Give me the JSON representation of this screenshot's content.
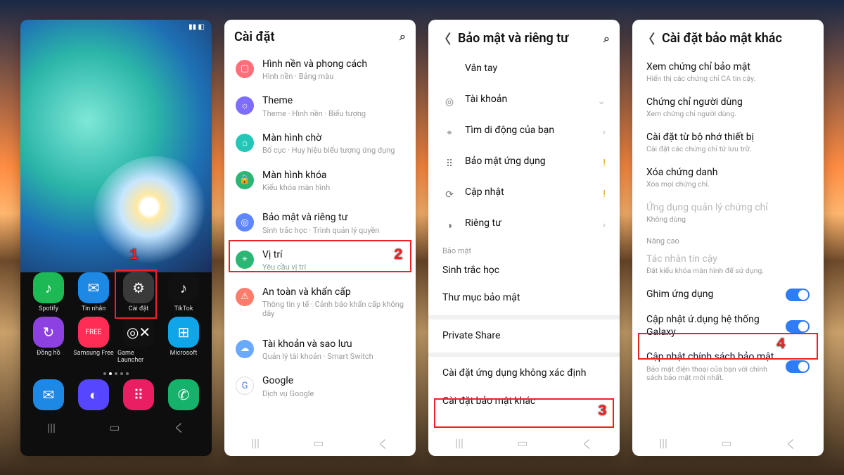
{
  "panel1": {
    "apps_row1": [
      {
        "name": "Spotify",
        "color": "#1db954",
        "glyph": "♪"
      },
      {
        "name": "Tin nhắn",
        "color": "#1e88e5",
        "glyph": "✉"
      },
      {
        "name": "Cài đặt",
        "color": "#3a3a3a",
        "glyph": "⚙"
      },
      {
        "name": "TikTok",
        "color": "#111",
        "glyph": "♪"
      }
    ],
    "apps_row2": [
      {
        "name": "Đồng hồ",
        "color": "#8d41e0",
        "glyph": "↻"
      },
      {
        "name": "Samsung Free",
        "color": "#ff2d55",
        "glyph": "FREE"
      },
      {
        "name": "Game Launcher",
        "color": "#111",
        "glyph": "◎✕"
      },
      {
        "name": "Microsoft",
        "color": "#0ea5e9",
        "glyph": "⊞"
      }
    ],
    "dock": [
      {
        "name": "Messages",
        "color": "#1e88e5",
        "glyph": "✉"
      },
      {
        "name": "Internet",
        "color": "#5746ff",
        "glyph": "◐"
      },
      {
        "name": "Apps",
        "color": "#e91e63",
        "glyph": "⠿"
      },
      {
        "name": "Phone",
        "color": "#16b26b",
        "glyph": "✆"
      }
    ],
    "step": "1"
  },
  "panel2": {
    "title": "Cài đặt",
    "items": [
      {
        "c": "#ff6f7a",
        "g": "▢",
        "t": "Hình nền và phong cách",
        "s": "Hình nền · Bảng màu"
      },
      {
        "c": "#7c6cff",
        "g": "☼",
        "t": "Theme",
        "s": "Theme · Hình nền · Biểu tượng"
      },
      {
        "c": "#25c6b8",
        "g": "⌂",
        "t": "Màn hình chờ",
        "s": "Bố cục · Huy hiệu biểu tượng ứng dụng"
      },
      {
        "c": "#2bb673",
        "g": "🔒",
        "t": "Màn hình khóa",
        "s": "Kiểu khóa màn hình"
      },
      {
        "c": "#5e86ff",
        "g": "◎",
        "t": "Bảo mật và riêng tư",
        "s": "Sinh trắc học · Trình quản lý quyền"
      },
      {
        "c": "#2bb673",
        "g": "⌖",
        "t": "Vị trí",
        "s": "Yêu cầu vị trí"
      },
      {
        "c": "#ff7b6b",
        "g": "⚠",
        "t": "An toàn và khẩn cấp",
        "s": "Thông tin y tế · Cảnh báo khẩn cấp không dây"
      },
      {
        "c": "#6aa9ff",
        "g": "☁",
        "t": "Tài khoản và sao lưu",
        "s": "Quản lý tài khoản · Smart Switch"
      },
      {
        "c": "#fff",
        "g": "G",
        "t": "Google",
        "s": "Dịch vụ Google",
        "gstyle": "color:#4285f4;border:1px solid #ddd"
      }
    ],
    "step": "2"
  },
  "panel3": {
    "title": "Bảo mật và riêng tư",
    "group1": [
      {
        "g": "",
        "t": "Vân tay"
      },
      {
        "g": "◎",
        "t": "Tài khoản",
        "r": "⌄"
      },
      {
        "g": "⌖",
        "t": "Tìm di động của bạn",
        "r": "›"
      },
      {
        "g": "⠿",
        "t": "Bảo mật ứng dụng",
        "r": "!",
        "warn": true
      },
      {
        "g": "⟳",
        "t": "Cập nhật",
        "r": "!",
        "warn": true
      },
      {
        "g": "◑",
        "t": "Riêng tư",
        "r": "›"
      }
    ],
    "sect1": "Bảo mật",
    "group2": [
      {
        "t": "Sinh trắc học"
      },
      {
        "t": "Thư mục bảo mật"
      },
      {
        "t": "Private Share"
      },
      {
        "t": "Cài đặt ứng dụng không xác định"
      },
      {
        "t": "Cài đặt bảo mật khác"
      }
    ],
    "step": "3"
  },
  "panel4": {
    "title": "Cài đặt bảo mật khác",
    "items": [
      {
        "t": "Xem chứng chỉ bảo mật",
        "s": "Hiển thị các chứng chỉ CA tin cậy."
      },
      {
        "t": "Chứng chỉ người dùng",
        "s": "Xem chứng chỉ người dùng."
      },
      {
        "t": "Cài đặt từ bộ nhớ thiết bị",
        "s": "Cài đặt các chứng chỉ từ lưu trữ."
      },
      {
        "t": "Xóa chứng danh",
        "s": "Xóa mọi chứng chỉ."
      },
      {
        "t": "Ứng dụng quản lý chứng chỉ",
        "s": "Không dùng",
        "muted": true
      }
    ],
    "sect": "Nâng cao",
    "items2": [
      {
        "t": "Tác nhân tin cậy",
        "s": "Đặt kiểu khóa màn hình để sử dụng.",
        "muted": true
      },
      {
        "t": "Ghim ứng dụng",
        "tog": true
      },
      {
        "t": "Cập nhật ứ.dụng hệ thống Galaxy",
        "tog": true
      },
      {
        "t": "Cập nhật chính sách bảo mật",
        "s": "Bảo mật điện thoại của bạn với chính sách bảo mật mới nhất.",
        "tog": true
      }
    ],
    "step": "4"
  }
}
